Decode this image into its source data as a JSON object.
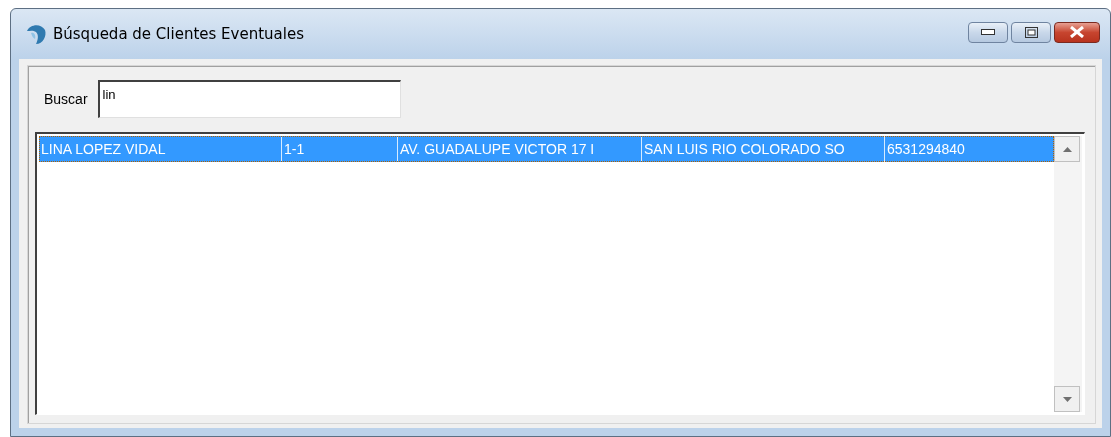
{
  "window": {
    "title": "Búsqueda de Clientes Eventuales"
  },
  "search": {
    "label": "Buscar",
    "value": "lin"
  },
  "rows": [
    {
      "selected": true,
      "cells": [
        "LINA LOPEZ VIDAL",
        "1-1",
        "AV. GUADALUPE VICTOR 17 I",
        "SAN LUIS RIO COLORADO SO",
        "6531294840"
      ]
    }
  ]
}
